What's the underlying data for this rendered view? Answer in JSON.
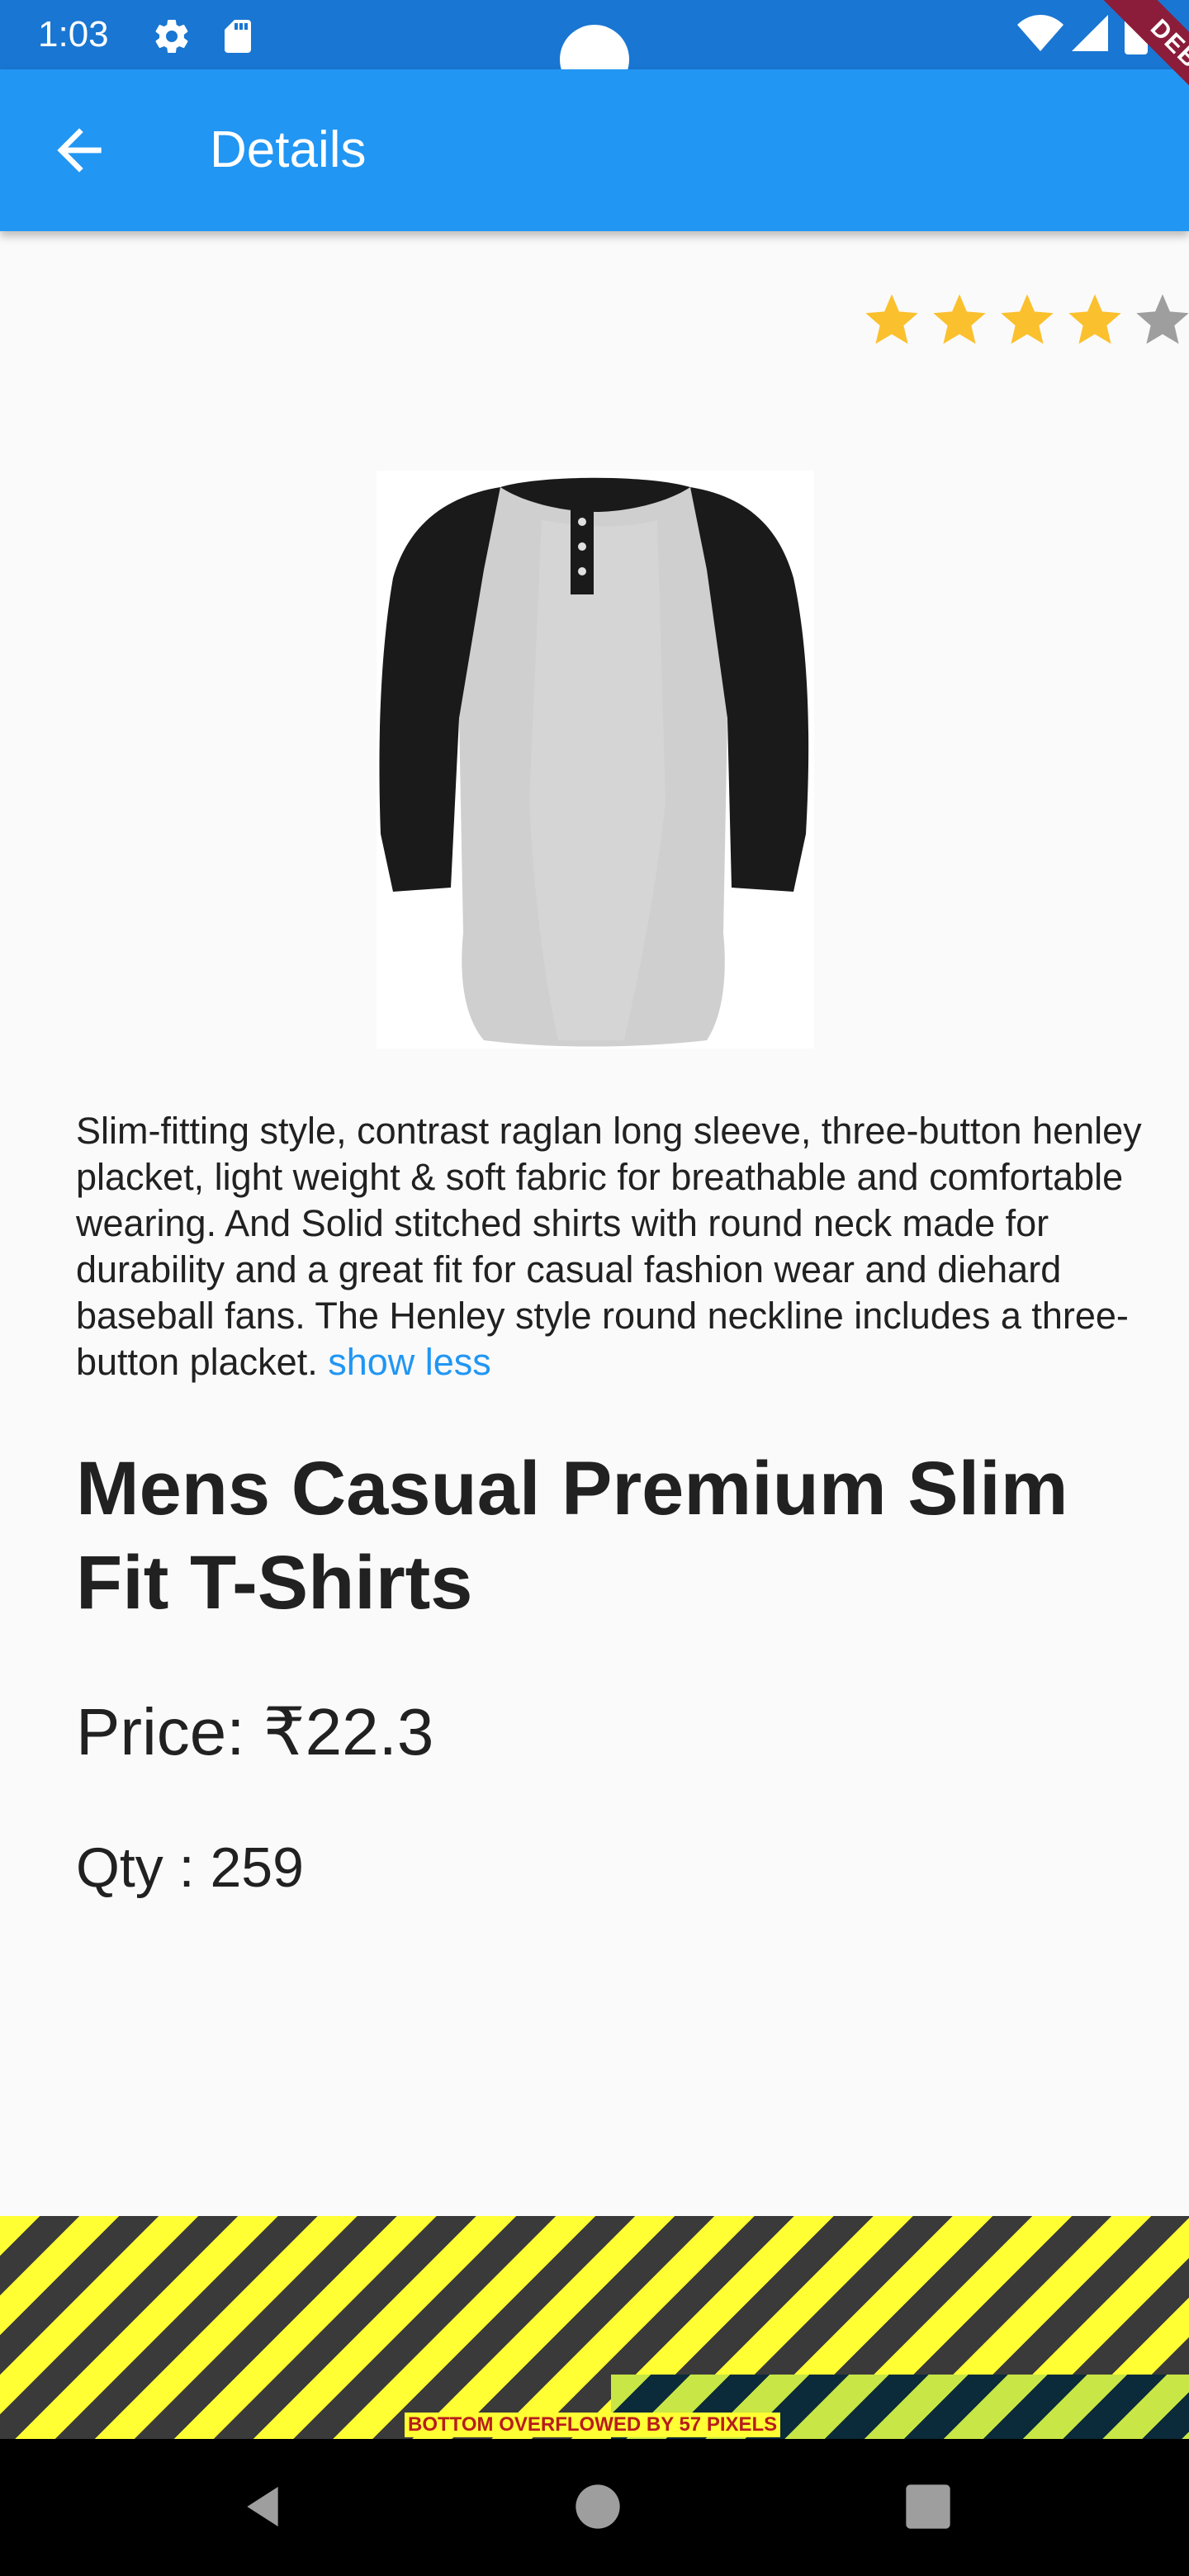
{
  "status_bar": {
    "time": "1:03",
    "icons": [
      "gear-icon",
      "sd-card-icon",
      "wifi-icon",
      "signal-icon",
      "battery-icon"
    ]
  },
  "app_bar": {
    "title": "Details",
    "back_icon": "arrow-back-icon"
  },
  "debug_banner": {
    "label": "DEBUG"
  },
  "rating": {
    "value": 4,
    "max": 5,
    "filled_color": "#fbc02d",
    "empty_color": "#9e9e9e"
  },
  "product": {
    "image": "henley-shirt-image",
    "description": "Slim-fitting style, contrast raglan long sleeve, three-button henley placket, light weight & soft fabric for breathable and comfortable wearing. And Solid stitched shirts with round neck made for durability and a great fit for casual fashion wear and diehard baseball fans. The Henley style round neckline includes a three-button placket.",
    "toggle_label": "show less",
    "title": "Mens Casual Premium Slim Fit T-Shirts",
    "price_text": "Price:  ₹22.3",
    "qty_text": "Qty : 259"
  },
  "overflow_warning": {
    "label": "BOTTOM OVERFLOWED BY 57 PIXELS"
  },
  "nav_bar": {
    "buttons": [
      "back-nav-icon",
      "home-nav-icon",
      "recents-nav-icon"
    ]
  },
  "colors": {
    "primary": "#2196f3",
    "primary_dark": "#1976d2",
    "link": "#2196f3"
  }
}
